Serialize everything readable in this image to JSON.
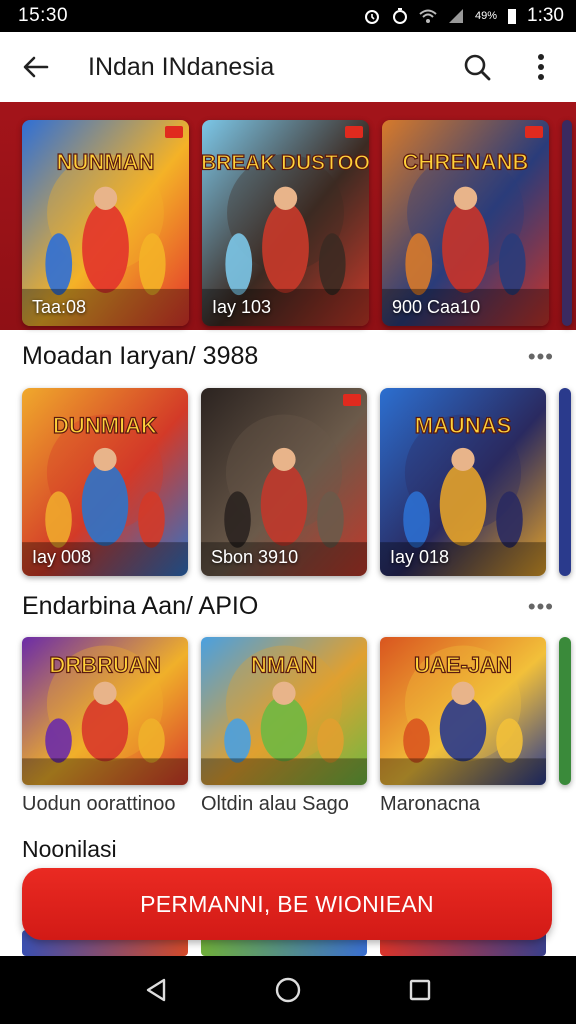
{
  "status_bar": {
    "time_left": "15:30",
    "time_right": "1:30",
    "battery_text": "49%"
  },
  "app_bar": {
    "title": "INdan INdanesia"
  },
  "hero": {
    "cards": [
      {
        "caption": "Taa:08",
        "art_title": "NUNMAN",
        "palette": [
          "#2f6fd6",
          "#e2342b",
          "#f4b227"
        ]
      },
      {
        "caption": "Iay 103",
        "art_title": "BREAK DUSTOO",
        "palette": [
          "#7cc7e8",
          "#c93a2a",
          "#3c2a22"
        ]
      },
      {
        "caption": "900 Caa10",
        "art_title": "CHRENANB",
        "palette": [
          "#d77a2b",
          "#c8342a",
          "#2a3c7a"
        ]
      }
    ]
  },
  "section1": {
    "title": "Moadan Iaryan/ 3988",
    "more": "•••",
    "cards": [
      {
        "caption": "Iay 008",
        "art_title": "DUNMIAK",
        "palette": [
          "#f0a92c",
          "#2f73c8",
          "#d33a28"
        ]
      },
      {
        "caption": "Sbon 3910",
        "art_title": "",
        "palette": [
          "#2b2320",
          "#c0392b",
          "#6b5a4a"
        ]
      },
      {
        "caption": "Iay 018",
        "art_title": "MAUNAS",
        "palette": [
          "#2c6fd0",
          "#e3a22a",
          "#2a2a60"
        ]
      }
    ]
  },
  "section2": {
    "title": "Endarbina Aan/  APIO",
    "more": "•••",
    "cards": [
      {
        "label": "Uodun oorattinoo",
        "art_title": "DRBRUAN",
        "palette": [
          "#6b2ba8",
          "#d83a2a",
          "#f0b02a"
        ]
      },
      {
        "label": "Oltdin alau Sago",
        "art_title": "NMAN",
        "palette": [
          "#4aa0e0",
          "#6fb842",
          "#e0a030"
        ]
      },
      {
        "label": "Maronacna",
        "art_title": "UAE-JAN",
        "palette": [
          "#d9551f",
          "#2a3a8c",
          "#f2c03a"
        ]
      }
    ]
  },
  "section3": {
    "title": "Noonilasi"
  },
  "cta": {
    "label": "PERMANNI, BE WIONIEAN"
  },
  "colors": {
    "accent": "#d21a16",
    "hero_band": "#a3141a"
  }
}
